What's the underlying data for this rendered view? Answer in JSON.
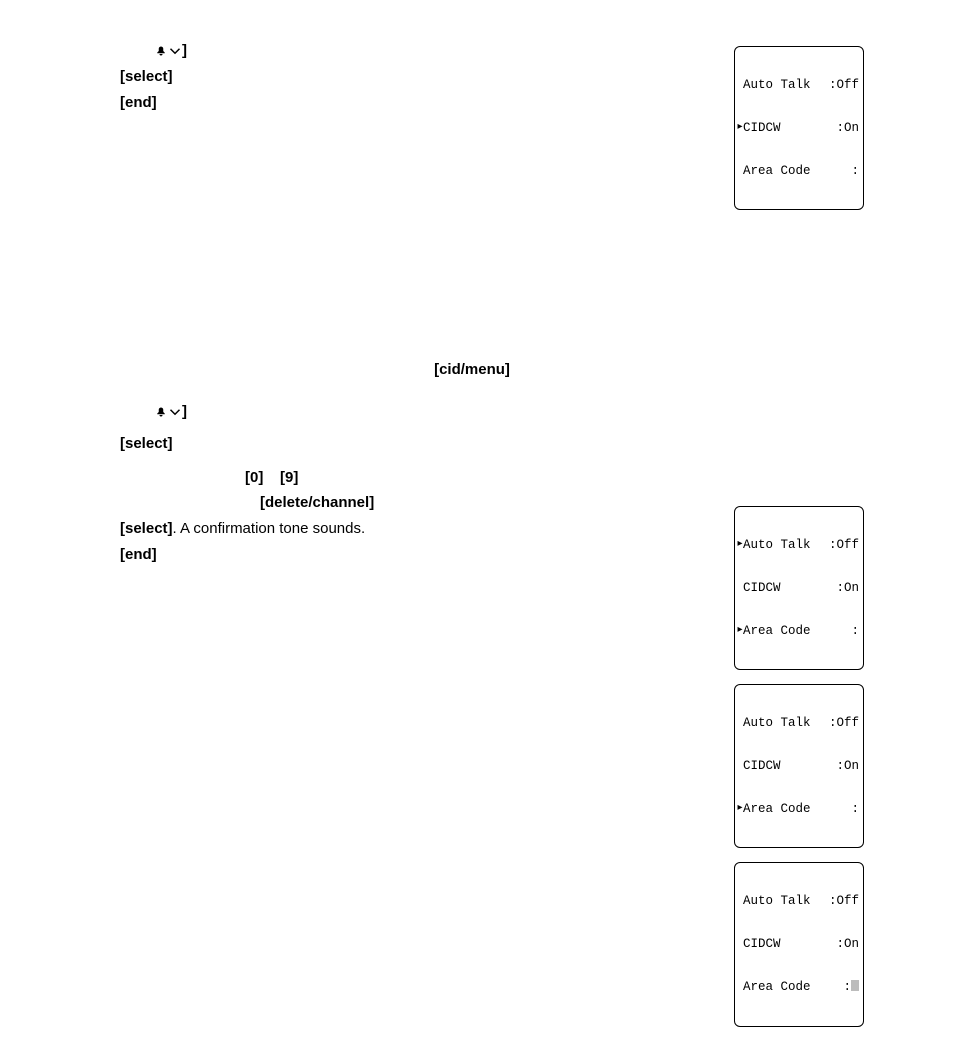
{
  "instructions": {
    "line1_bell": "]",
    "line2": "[select]",
    "line3": "[end]",
    "line4": "[cid/menu]",
    "line5_bell": "]",
    "line6": "[select]",
    "line7_a": "[0]",
    "line7_b": "[9]",
    "line8": "[delete/channel]",
    "line9_a": "[select]",
    "line9_b": ". A confirmation tone sounds.",
    "line10": "[end]"
  },
  "lcd_labels": {
    "auto_talk": "Auto Talk",
    "cidcw": "CIDCW",
    "area_code": "Area Code"
  },
  "lcd_vals": {
    "off": ":Off",
    "on": ":On",
    "blank": ":"
  }
}
